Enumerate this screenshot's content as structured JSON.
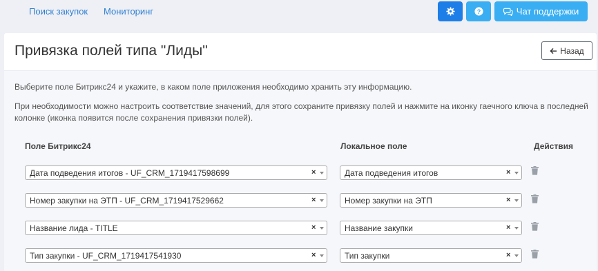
{
  "nav": {
    "search_label": "Поиск закупок",
    "monitor_label": "Мониторинг"
  },
  "top_buttons": {
    "support_label": "Чат поддержки",
    "settings_icon": "gear-icon",
    "help_icon": "question-icon"
  },
  "page": {
    "title": "Привязка полей типа \"Лиды\"",
    "back_label": "Назад",
    "desc1": "Выберите поле Битрикс24 и укажите, в каком поле приложения необходимо хранить эту информацию.",
    "desc2": "При необходимости можно настроить соответствие значений, для этого сохраните привязку полей и нажмите на иконку гаечного ключа в последней колонке (иконка появится после сохранения привязки полей)."
  },
  "table": {
    "headers": {
      "bitrix": "Поле Битрикс24",
      "local": "Локальное поле",
      "actions": "Действия"
    },
    "rows": [
      {
        "bitrix": "Дата подведения итогов - UF_CRM_1719417598699",
        "local": "Дата подведения итогов"
      },
      {
        "bitrix": "Номер закупки на ЭТП - UF_CRM_1719417529662",
        "local": "Номер закупки на ЭТП"
      },
      {
        "bitrix": "Название лида - TITLE",
        "local": "Название закупки"
      },
      {
        "bitrix": "Тип закупки - UF_CRM_1719417541930",
        "local": "Тип закупки"
      }
    ]
  },
  "colors": {
    "accent": "#3aaef2",
    "primary": "#1e7ee8",
    "link": "#2f7fd1"
  }
}
